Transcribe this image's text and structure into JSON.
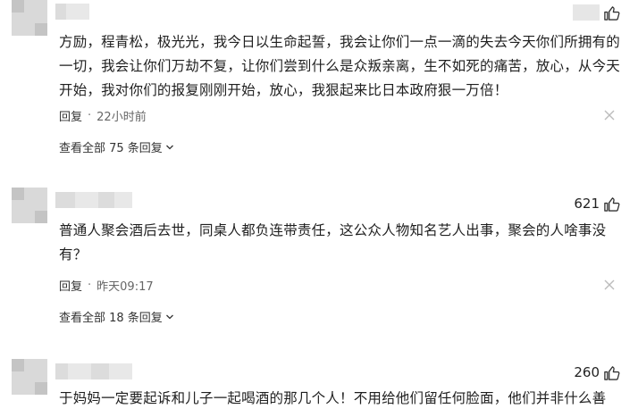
{
  "comments": [
    {
      "likes": "",
      "text": "方励，程青松，极光光，我今日以生命起誓，我会让你们一点一滴的失去今天你们所拥有的一切，我会让你们万劫不复，让你们尝到什么是众叛亲离，生不如死的痛苦，放心，从今天开始，我对你们的报复刚刚开始，放心，我狠起来比日本政府狠一万倍！",
      "reply_label": "回复",
      "time": "22小时前",
      "view_replies": "查看全部 75 条回复"
    },
    {
      "likes": "621",
      "text": "普通人聚会酒后去世，同桌人都负连带责任，这公众人物知名艺人出事，聚会的人啥事没有？",
      "reply_label": "回复",
      "time": "昨天09:17",
      "view_replies": "查看全部 18 条回复"
    },
    {
      "likes": "260",
      "text": "于妈妈一定要起诉和儿子一起喝酒的那几个人！不用给他们留任何脸面，他们并非什么善"
    }
  ],
  "icons": {
    "like": "thumbs-up-icon",
    "close": "close-icon",
    "expand": "chevron-down-icon"
  }
}
